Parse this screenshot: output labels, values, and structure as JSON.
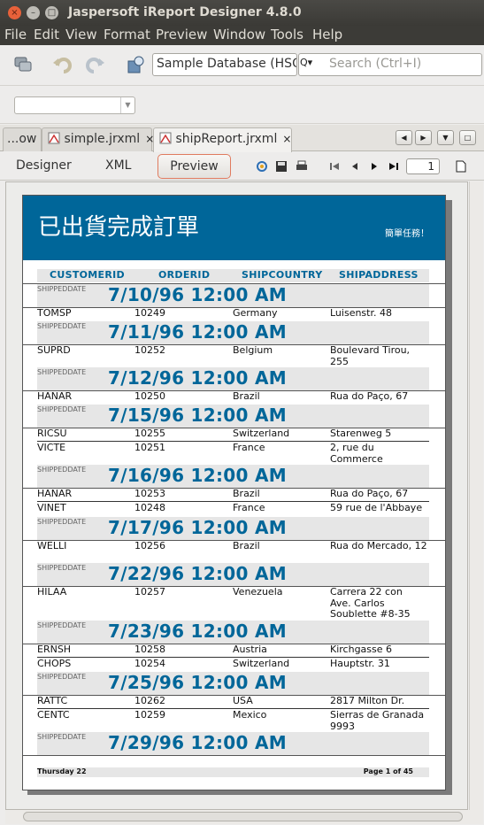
{
  "window": {
    "title": "Jaspersoft iReport Designer 4.8.0",
    "buttons": {
      "close": "×",
      "minimize": "–",
      "maximize": "□"
    }
  },
  "menu": [
    "File",
    "Edit",
    "View",
    "Format",
    "Preview",
    "Window",
    "Tools",
    "Help"
  ],
  "toolbar": {
    "datasource": "Sample Database (HSQLDB)",
    "search_placeholder": "Search (Ctrl+I)",
    "search_button": "Q▾"
  },
  "tabs": [
    {
      "label": "...ow",
      "closable": false
    },
    {
      "label": "simple.jrxml",
      "closable": true
    },
    {
      "label": "shipReport.jrxml",
      "closable": true,
      "active": true
    }
  ],
  "tab_close": "×",
  "nav_buttons": [
    "◀",
    "▶",
    "▼",
    "□"
  ],
  "designer_tabs": {
    "designer": "Designer",
    "xml": "XML",
    "preview": "Preview"
  },
  "page_number": "1",
  "report": {
    "title": "已出貨完成訂單",
    "subtitle": "簡單任務！",
    "columns": [
      "CUSTOMERID",
      "ORDERID",
      "SHIPCOUNTRY",
      "SHIPADDRESS"
    ],
    "group_label": "SHIPPEDDATE",
    "groups": [
      {
        "date": "7/10/96 12:00 AM",
        "rows": [
          [
            "TOMSP",
            "10249",
            "Germany",
            "Luisenstr. 48"
          ]
        ]
      },
      {
        "date": "7/11/96 12:00 AM",
        "rows": [
          [
            "SUPRD",
            "10252",
            "Belgium",
            "Boulevard Tirou, 255"
          ]
        ]
      },
      {
        "date": "7/12/96 12:00 AM",
        "rows": [
          [
            "HANAR",
            "10250",
            "Brazil",
            "Rua do Paço, 67"
          ]
        ]
      },
      {
        "date": "7/15/96 12:00 AM",
        "rows": [
          [
            "RICSU",
            "10255",
            "Switzerland",
            "Starenweg 5"
          ],
          [
            "VICTE",
            "10251",
            "France",
            "2, rue du Commerce"
          ]
        ]
      },
      {
        "date": "7/16/96 12:00 AM",
        "rows": [
          [
            "HANAR",
            "10253",
            "Brazil",
            "Rua do Paço, 67"
          ],
          [
            "VINET",
            "10248",
            "France",
            "59 rue de l'Abbaye"
          ]
        ]
      },
      {
        "date": "7/17/96 12:00 AM",
        "rows": [
          [
            "WELLI",
            "10256",
            "Brazil",
            "Rua do Mercado, 12"
          ]
        ]
      },
      {
        "date": "7/22/96 12:00 AM",
        "rows": [
          [
            "HILAA",
            "10257",
            "Venezuela",
            "Carrera 22 con Ave. Carlos Soublette #8-35"
          ]
        ]
      },
      {
        "date": "7/23/96 12:00 AM",
        "rows": [
          [
            "ERNSH",
            "10258",
            "Austria",
            "Kirchgasse 6"
          ],
          [
            "CHOPS",
            "10254",
            "Switzerland",
            "Hauptstr. 31"
          ]
        ]
      },
      {
        "date": "7/25/96 12:00 AM",
        "rows": [
          [
            "RATTC",
            "10262",
            "USA",
            "2817 Milton Dr."
          ],
          [
            "CENTC",
            "10259",
            "Mexico",
            "Sierras de Granada 9993"
          ]
        ]
      },
      {
        "date": "7/29/96 12:00 AM",
        "rows": []
      }
    ],
    "footer_left": "Thursday 22",
    "footer_right": "Page 1 of 45"
  },
  "colors": {
    "report_accent": "#006699",
    "titlebar": "#3c3b37",
    "close_button": "#e8613a"
  }
}
